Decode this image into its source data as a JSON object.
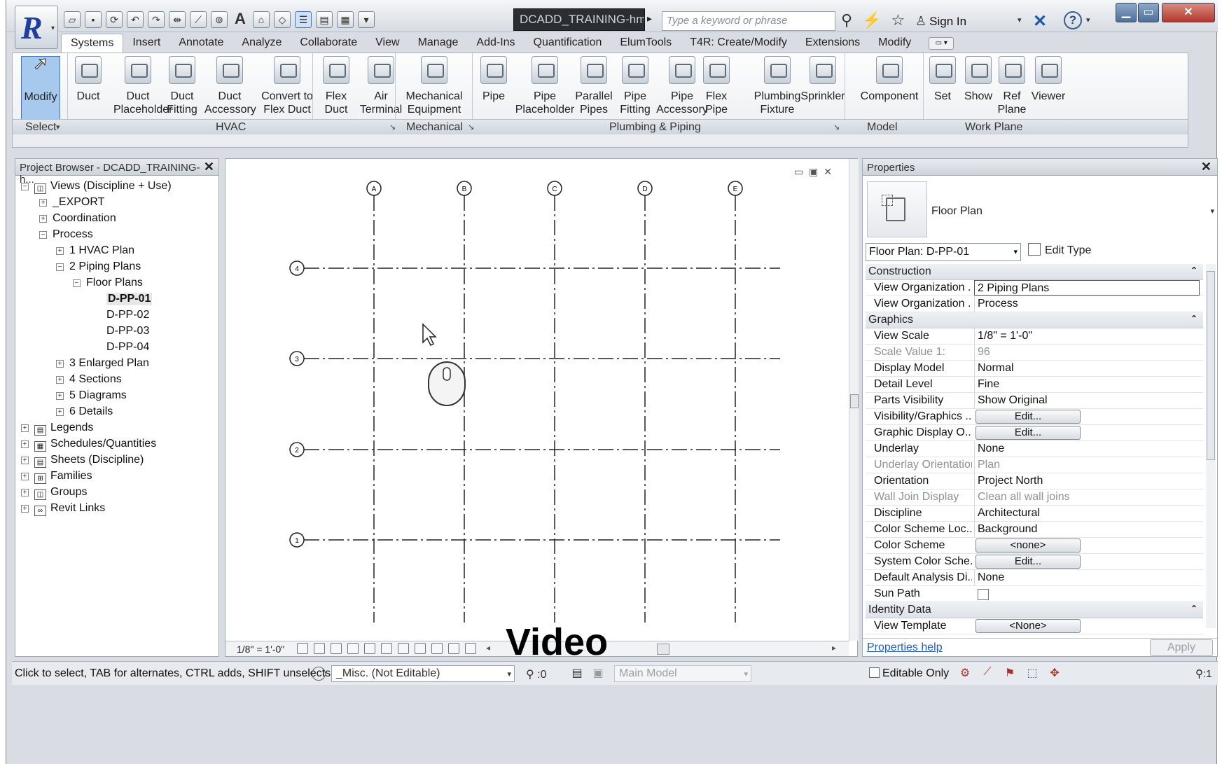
{
  "title_bar": {
    "app_letter": "R",
    "document_title": "DCADD_TRAINING-hm...",
    "search_placeholder": "Type a keyword or phrase",
    "sign_in": "Sign In",
    "help_glyph": "?",
    "win_min": "▁",
    "win_max": "▭",
    "win_close": "✕"
  },
  "tabs": [
    "Systems",
    "Insert",
    "Annotate",
    "Analyze",
    "Collaborate",
    "View",
    "Manage",
    "Add-Ins",
    "Quantification",
    "ElumTools",
    "T4R: Create/Modify",
    "Extensions",
    "Modify"
  ],
  "ribbon": {
    "buttons": [
      {
        "label": "Modify",
        "icon": "cursor-arrow-icon"
      },
      {
        "label": "Duct",
        "icon": "duct-icon"
      },
      {
        "label": "Duct\nPlaceholder",
        "icon": "duct-placeholder-icon"
      },
      {
        "label": "Duct\nFitting",
        "icon": "duct-fitting-icon"
      },
      {
        "label": "Duct\nAccessory",
        "icon": "duct-accessory-icon"
      },
      {
        "label": "Convert to\nFlex Duct",
        "icon": "convert-flex-duct-icon"
      },
      {
        "label": "Flex\nDuct",
        "icon": "flex-duct-icon"
      },
      {
        "label": "Air\nTerminal",
        "icon": "air-terminal-icon"
      },
      {
        "label": "Mechanical\nEquipment",
        "icon": "mechanical-equipment-icon"
      },
      {
        "label": "Pipe",
        "icon": "pipe-icon"
      },
      {
        "label": "Pipe\nPlaceholder",
        "icon": "pipe-placeholder-icon"
      },
      {
        "label": "Parallel\nPipes",
        "icon": "parallel-pipes-icon"
      },
      {
        "label": "Pipe\nFitting",
        "icon": "pipe-fitting-icon"
      },
      {
        "label": "Pipe\nAccessory",
        "icon": "pipe-accessory-icon"
      },
      {
        "label": "Flex\nPipe",
        "icon": "flex-pipe-icon"
      },
      {
        "label": "Plumbing\nFixture",
        "icon": "plumbing-fixture-icon"
      },
      {
        "label": "Sprinkler",
        "icon": "sprinkler-icon"
      },
      {
        "label": "Component",
        "icon": "component-icon"
      },
      {
        "label": "Set",
        "icon": "set-workplane-icon"
      },
      {
        "label": "Show",
        "icon": "show-workplane-icon"
      },
      {
        "label": "Ref\nPlane",
        "icon": "ref-plane-icon"
      },
      {
        "label": "Viewer",
        "icon": "viewer-icon"
      }
    ],
    "panels": [
      "Select",
      "HVAC",
      "Mechanical",
      "Plumbing & Piping",
      "Model",
      "Work Plane"
    ]
  },
  "project_browser": {
    "title": "Project Browser - DCADD_TRAINING-h...",
    "items": [
      {
        "label": "Views (Discipline + Use)",
        "exp": "−"
      },
      {
        "label": "_EXPORT",
        "exp": "+"
      },
      {
        "label": "Coordination",
        "exp": "+"
      },
      {
        "label": "Process",
        "exp": "−"
      },
      {
        "label": "1 HVAC Plan",
        "exp": "+"
      },
      {
        "label": "2 Piping Plans",
        "exp": "−"
      },
      {
        "label": "Floor Plans",
        "exp": "−"
      },
      {
        "label": "D-PP-01",
        "exp": ""
      },
      {
        "label": "D-PP-02",
        "exp": ""
      },
      {
        "label": "D-PP-03",
        "exp": ""
      },
      {
        "label": "D-PP-04",
        "exp": ""
      },
      {
        "label": "3 Enlarged Plan",
        "exp": "+"
      },
      {
        "label": "4 Sections",
        "exp": "+"
      },
      {
        "label": "5 Diagrams",
        "exp": "+"
      },
      {
        "label": "6 Details",
        "exp": "+"
      },
      {
        "label": "Legends",
        "exp": "+"
      },
      {
        "label": "Schedules/Quantities",
        "exp": "+"
      },
      {
        "label": "Sheets (Discipline)",
        "exp": "+"
      },
      {
        "label": "Families",
        "exp": "+"
      },
      {
        "label": "Groups",
        "exp": "+"
      },
      {
        "label": "Revit Links",
        "exp": "+"
      }
    ]
  },
  "view": {
    "grid_columns": [
      "A",
      "B",
      "C",
      "D",
      "E"
    ],
    "grid_rows": [
      "4",
      "3",
      "2",
      "1"
    ],
    "scale": "1/8\" = 1'-0\"",
    "overlay_label": "Video"
  },
  "properties": {
    "title": "Properties",
    "type_name": "Floor Plan",
    "instance_selector": "Floor Plan: D-PP-01",
    "edit_type": "Edit Type",
    "sections": [
      {
        "header": "Construction",
        "rows": [
          {
            "name": "View Organization ...",
            "value": "2 Piping Plans",
            "style": "boxed"
          },
          {
            "name": "View Organization ...",
            "value": "Process"
          }
        ]
      },
      {
        "header": "Graphics",
        "rows": [
          {
            "name": "View Scale",
            "value": "1/8\" = 1'-0\""
          },
          {
            "name": "Scale Value    1:",
            "value": "96",
            "style": "dis"
          },
          {
            "name": "Display Model",
            "value": "Normal"
          },
          {
            "name": "Detail Level",
            "value": "Fine"
          },
          {
            "name": "Parts Visibility",
            "value": "Show Original"
          },
          {
            "name": "Visibility/Graphics ...",
            "value": "Edit...",
            "style": "btn"
          },
          {
            "name": "Graphic Display O...",
            "value": "Edit...",
            "style": "btn"
          },
          {
            "name": "Underlay",
            "value": "None"
          },
          {
            "name": "Underlay Orientation",
            "value": "Plan",
            "style": "dis"
          },
          {
            "name": "Orientation",
            "value": "Project North"
          },
          {
            "name": "Wall Join Display",
            "value": "Clean all wall joins",
            "style": "dis"
          },
          {
            "name": "Discipline",
            "value": "Architectural"
          },
          {
            "name": "Color Scheme Loc...",
            "value": "Background"
          },
          {
            "name": "Color Scheme",
            "value": "<none>",
            "style": "btn"
          },
          {
            "name": "System Color Sche...",
            "value": "Edit...",
            "style": "btn"
          },
          {
            "name": "Default Analysis Di...",
            "value": "None"
          },
          {
            "name": "Sun Path",
            "value": "",
            "style": "chk"
          }
        ]
      },
      {
        "header": "Identity Data",
        "rows": [
          {
            "name": "View Template",
            "value": "<None>",
            "style": "btn"
          }
        ]
      }
    ],
    "help_link": "Properties help",
    "apply": "Apply"
  },
  "status_bar": {
    "message": "Click to select, TAB for alternates, CTRL adds, SHIFT unselects.",
    "workset": "_Misc. (Not Editable)",
    "selection_count": ":0",
    "design_option": "Main Model",
    "editable_only": "Editable Only",
    "filter_count": ":1"
  }
}
